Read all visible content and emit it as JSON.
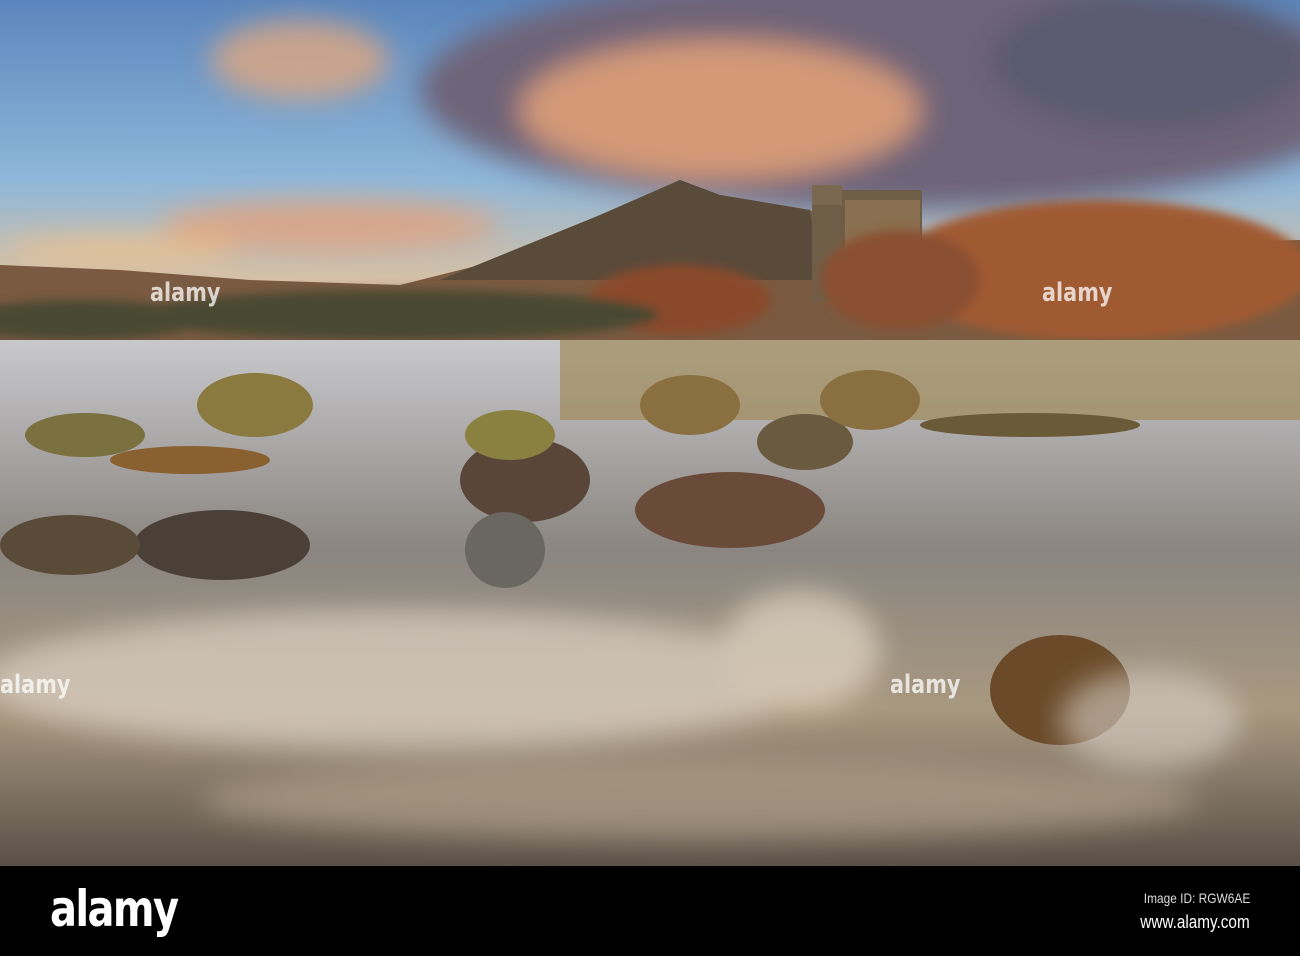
{
  "watermark": {
    "text": "alamy"
  },
  "footer": {
    "logo": "alamy",
    "image_id": "Image ID: RGW6AE",
    "site": "www.alamy.com"
  },
  "colors": {
    "sky_top": "#4a7fb8",
    "sky_warm": "#e9b27a",
    "cloud": "#8a7080",
    "water": "#b9b3ad",
    "footer": "#000000"
  }
}
